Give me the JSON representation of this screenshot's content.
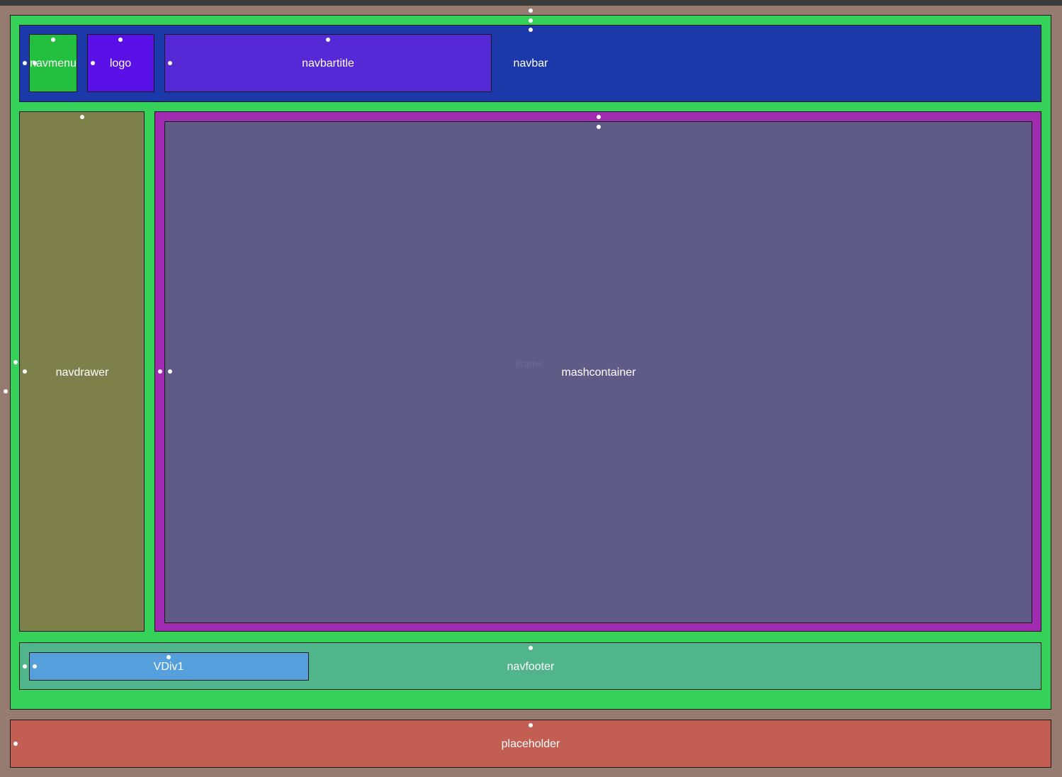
{
  "colors": {
    "root_background": "#957b70",
    "app_container": "#36d158",
    "navbar": "#1c39aa",
    "navmenu": "#22c03e",
    "logo": "#5a11e8",
    "navbartitle": "#5529d6",
    "navdrawer": "#7e804c",
    "mash_outer": "#a12bb1",
    "mashcontainer": "#5f5b86",
    "navfooter": "#50b58a",
    "vdiv1": "#559fdc",
    "placeholder": "#c35e53"
  },
  "labels": {
    "navmenu": "navmenu",
    "logo": "logo",
    "navbartitle": "navbartitle",
    "navbar": "navbar",
    "navdrawer": "navdrawer",
    "mashcontainer": "mashcontainer",
    "iframe": "iframe",
    "vdiv1": "VDiv1",
    "navfooter": "navfooter",
    "placeholder": "placeholder"
  }
}
